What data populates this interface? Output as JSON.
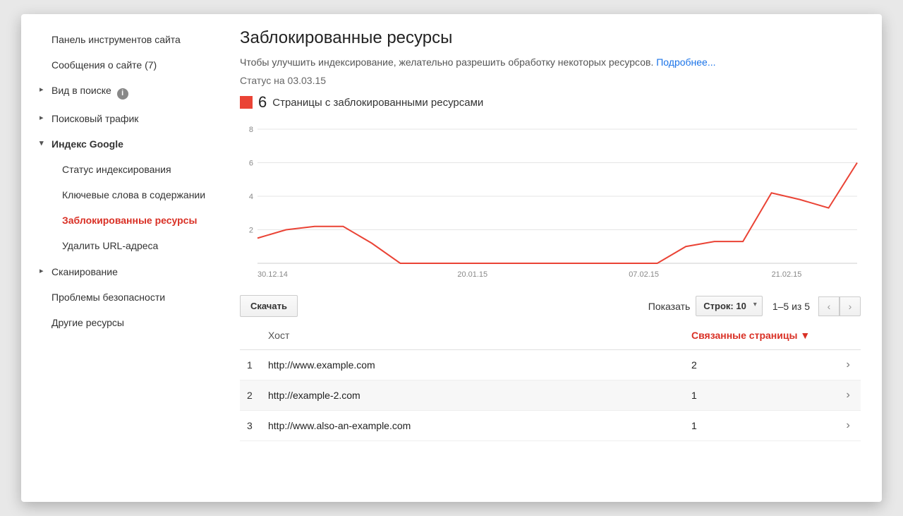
{
  "sidebar": {
    "dashboard": "Панель инструментов сайта",
    "messages": "Сообщения о сайте (7)",
    "search_appearance": "Вид в поиске",
    "search_traffic": "Поисковый трафик",
    "google_index": "Индекс Google",
    "index_status": "Статус индексирования",
    "content_keywords": "Ключевые слова в содержании",
    "blocked_resources": "Заблокированные ресурсы",
    "remove_urls": "Удалить URL-адреса",
    "crawl": "Сканирование",
    "security": "Проблемы безопасности",
    "other": "Другие ресурсы"
  },
  "page": {
    "title": "Заблокированные ресурсы",
    "subtext": "Чтобы улучшить индексирование, желательно разрешить обработку некоторых ресурсов. ",
    "learn_more": "Подробнее...",
    "status": "Статус на 03.03.15",
    "legend_count": "6",
    "legend_label": "Страницы с заблокированными ресурсами"
  },
  "chart_data": {
    "type": "line",
    "xlabel": "",
    "ylabel": "",
    "ylim": [
      0,
      8
    ],
    "yticks": [
      2,
      4,
      6,
      8
    ],
    "xticks": [
      "30.12.14",
      "20.01.15",
      "07.02.15",
      "21.02.15"
    ],
    "x": [
      "30.12.14",
      "02.01.15",
      "05.01.15",
      "08.01.15",
      "11.01.15",
      "14.01.15",
      "17.01.15",
      "20.01.15",
      "23.01.15",
      "26.01.15",
      "29.01.15",
      "01.02.15",
      "04.02.15",
      "07.02.15",
      "10.02.15",
      "13.02.15",
      "16.02.15",
      "19.02.15",
      "22.02.15",
      "25.02.15",
      "28.02.15",
      "03.03.15"
    ],
    "values": [
      1.5,
      2,
      2.2,
      2.2,
      1.2,
      0,
      0,
      0,
      0,
      0,
      0,
      0,
      0,
      0,
      0,
      1,
      1.3,
      1.3,
      4.2,
      3.8,
      3.3,
      6
    ]
  },
  "toolbar": {
    "download": "Скачать",
    "show_label": "Показать",
    "rows_select": "Строк: 10",
    "pagination": "1–5 из 5"
  },
  "table": {
    "headers": {
      "host": "Хост",
      "linked_pages": "Связанные страницы",
      "sort_indicator": "▼"
    },
    "rows": [
      {
        "idx": "1",
        "host": "http://www.example.com",
        "count": "2"
      },
      {
        "idx": "2",
        "host": "http://example-2.com",
        "count": "1"
      },
      {
        "idx": "3",
        "host": "http://www.also-an-example.com",
        "count": "1"
      }
    ]
  }
}
